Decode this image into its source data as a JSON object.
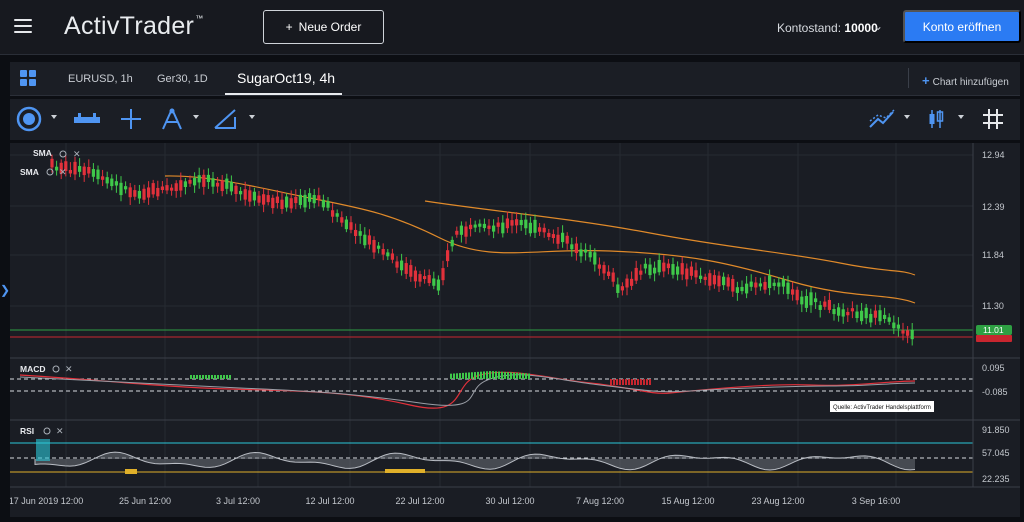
{
  "header": {
    "logo": "ActivTrader",
    "logo_tm": "™",
    "new_order_label": "Neue Order",
    "balance_label": "Kontostand:",
    "balance_value": "10000",
    "open_account_label": "Konto eröffnen"
  },
  "tabs": [
    {
      "label": "EURUSD, 1h"
    },
    {
      "label": "Ger30, 1D"
    },
    {
      "label": "SugarOct19, 4h",
      "active": true
    }
  ],
  "add_chart_label": "Chart hinzufügen",
  "toolbar_icons": [
    "crosshair-cursor-icon",
    "measure-tool-icon",
    "crosshair-icon",
    "fibonacci-icon",
    "drawing-icon",
    "indicator-icon",
    "candle-type-icon",
    "grid-icon"
  ],
  "indicators": {
    "sma1": "SMA",
    "sma2": "SMA",
    "macd": "MACD",
    "rsi": "RSI"
  },
  "price_axis": [
    "12.94",
    "12.39",
    "11.84",
    "11.30"
  ],
  "price_current": "11.01",
  "macd_axis": [
    "0.095",
    "-0.085"
  ],
  "rsi_axis": [
    "91.850",
    "57.045",
    "22.235"
  ],
  "x_axis": [
    "17 Jun 2019 12:00",
    "25 Jun 12:00",
    "3 Jul 12:00",
    "12 Jul 12:00",
    "22 Jul 12:00",
    "30 Jul 12:00",
    "7 Aug 12:00",
    "15 Aug 12:00",
    "23 Aug 12:00",
    "3 Sep 16:00"
  ],
  "source_label": "Quelle: ActivTrader Handelsplattform",
  "colors": {
    "up": "#3fc84a",
    "down": "#e2313b",
    "sma_orange": "#e08a2a",
    "accent": "#2b7bf3"
  }
}
